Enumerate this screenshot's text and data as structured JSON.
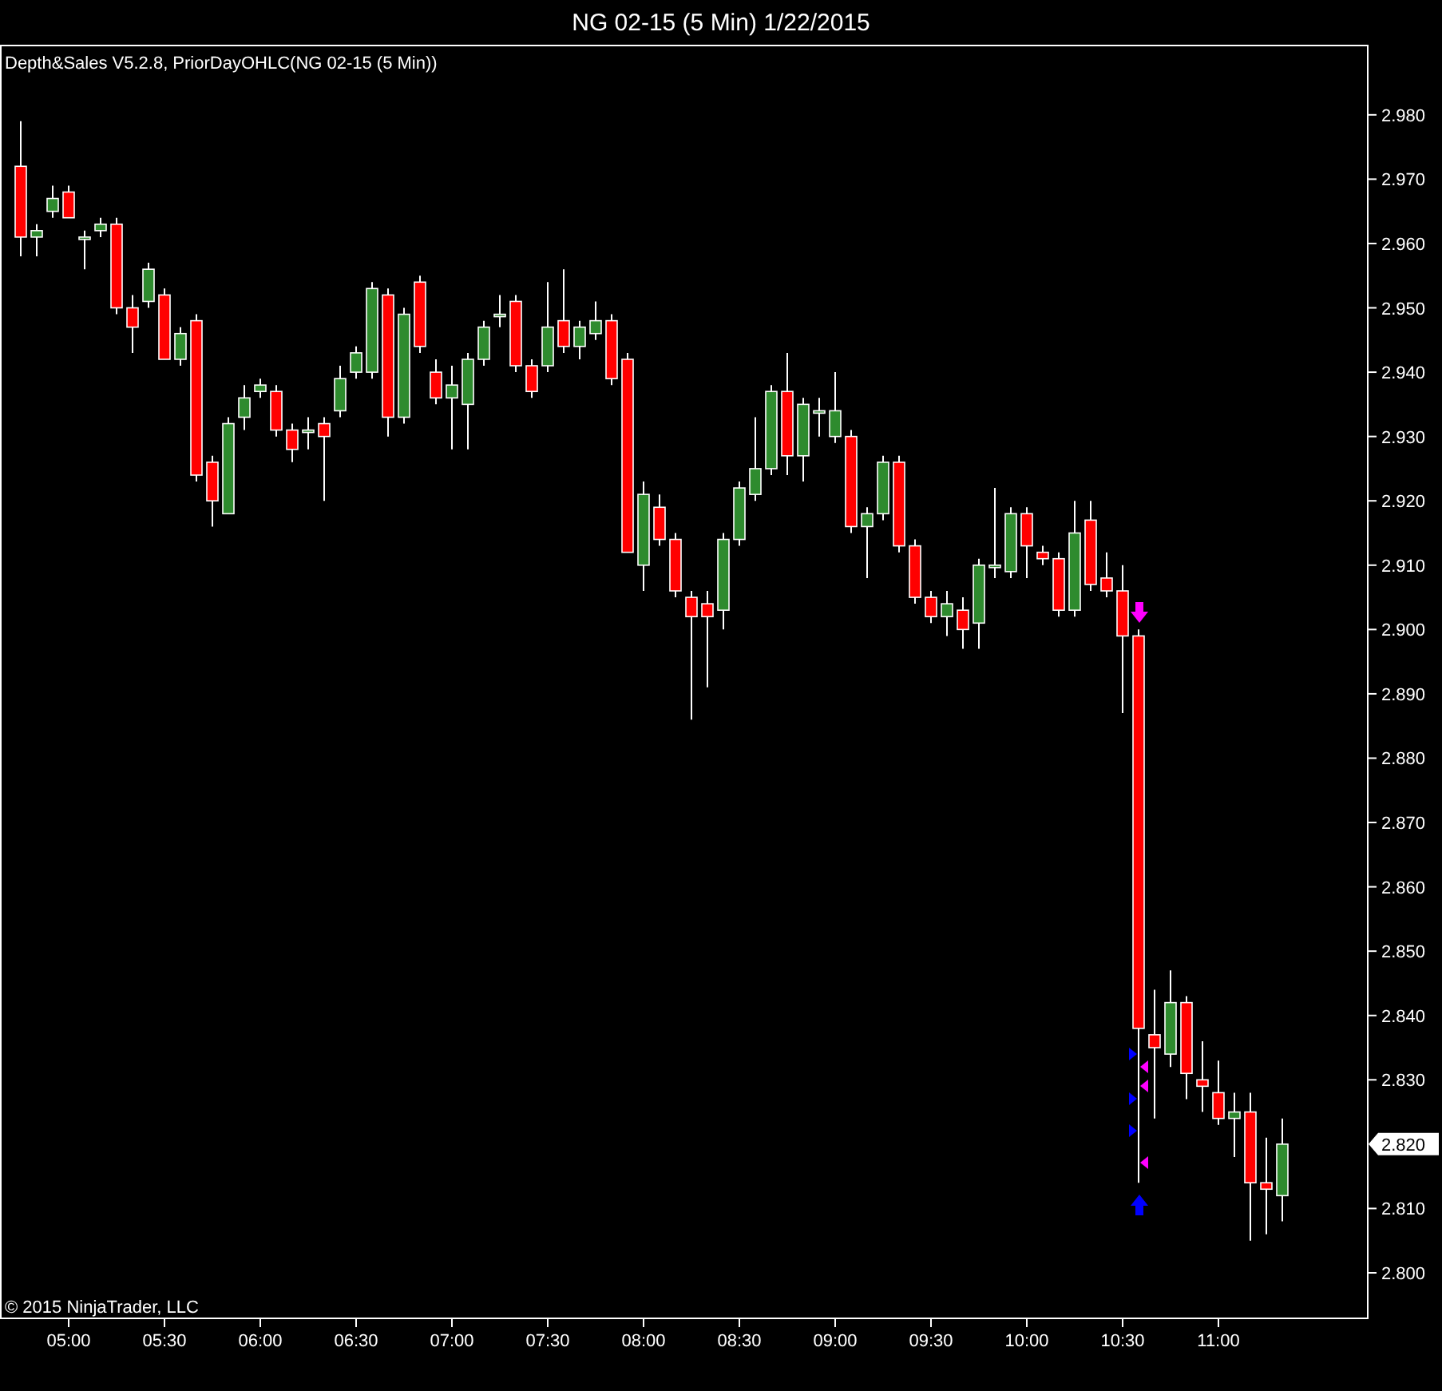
{
  "window": {
    "title": "NG 02-15 (5 Min)  1/22/2015"
  },
  "chart": {
    "indicator_label": "Depth&Sales V5.2.8, PriorDayOHLC(NG 02-15 (5 Min))",
    "chart_data": {
      "type": "candlestick",
      "x": [
        285,
        290,
        295,
        300,
        305,
        310,
        315,
        320,
        325,
        330,
        335,
        340,
        345,
        350,
        355,
        360,
        365,
        370,
        375,
        380,
        385,
        390,
        395,
        400,
        405,
        410,
        415,
        420,
        425,
        430,
        435,
        440,
        445,
        450,
        455,
        460,
        465,
        470,
        475,
        480,
        485,
        490,
        495,
        500,
        505,
        510,
        515,
        520,
        525,
        530,
        535,
        540,
        545,
        550,
        555,
        560,
        565,
        570,
        575,
        580,
        585,
        590,
        595,
        600,
        605,
        610,
        615,
        620,
        625,
        630,
        635,
        640,
        645,
        650,
        655,
        660,
        665,
        670,
        675,
        680
      ],
      "ohlc": [
        [
          2.972,
          2.979,
          2.958,
          2.961
        ],
        [
          2.961,
          2.963,
          2.958,
          2.962
        ],
        [
          2.965,
          2.969,
          2.964,
          2.967
        ],
        [
          2.968,
          2.969,
          2.964,
          2.964
        ],
        [
          2.961,
          2.962,
          2.956,
          2.961
        ],
        [
          2.962,
          2.964,
          2.961,
          2.963
        ],
        [
          2.963,
          2.964,
          2.949,
          2.95
        ],
        [
          2.95,
          2.952,
          2.943,
          2.947
        ],
        [
          2.951,
          2.957,
          2.95,
          2.956
        ],
        [
          2.952,
          2.953,
          2.942,
          2.942
        ],
        [
          2.942,
          2.947,
          2.941,
          2.946
        ],
        [
          2.948,
          2.949,
          2.923,
          2.924
        ],
        [
          2.926,
          2.927,
          2.916,
          2.92
        ],
        [
          2.918,
          2.933,
          2.918,
          2.932
        ],
        [
          2.933,
          2.938,
          2.931,
          2.936
        ],
        [
          2.937,
          2.939,
          2.936,
          2.938
        ],
        [
          2.937,
          2.938,
          2.93,
          2.931
        ],
        [
          2.931,
          2.932,
          2.926,
          2.928
        ],
        [
          2.931,
          2.933,
          2.928,
          2.931
        ],
        [
          2.932,
          2.933,
          2.92,
          2.93
        ],
        [
          2.934,
          2.941,
          2.933,
          2.939
        ],
        [
          2.94,
          2.944,
          2.939,
          2.943
        ],
        [
          2.94,
          2.954,
          2.939,
          2.953
        ],
        [
          2.952,
          2.953,
          2.93,
          2.933
        ],
        [
          2.933,
          2.95,
          2.932,
          2.949
        ],
        [
          2.954,
          2.955,
          2.943,
          2.944
        ],
        [
          2.94,
          2.942,
          2.935,
          2.936
        ],
        [
          2.936,
          2.941,
          2.928,
          2.938
        ],
        [
          2.935,
          2.943,
          2.928,
          2.942
        ],
        [
          2.942,
          2.948,
          2.941,
          2.947
        ],
        [
          2.949,
          2.952,
          2.947,
          2.949
        ],
        [
          2.951,
          2.952,
          2.94,
          2.941
        ],
        [
          2.941,
          2.942,
          2.936,
          2.937
        ],
        [
          2.941,
          2.954,
          2.94,
          2.947
        ],
        [
          2.948,
          2.956,
          2.943,
          2.944
        ],
        [
          2.944,
          2.948,
          2.942,
          2.947
        ],
        [
          2.946,
          2.951,
          2.945,
          2.948
        ],
        [
          2.948,
          2.949,
          2.938,
          2.939
        ],
        [
          2.942,
          2.943,
          2.912,
          2.912
        ],
        [
          2.91,
          2.923,
          2.906,
          2.921
        ],
        [
          2.919,
          2.921,
          2.913,
          2.914
        ],
        [
          2.914,
          2.915,
          2.905,
          2.906
        ],
        [
          2.905,
          2.906,
          2.886,
          2.902
        ],
        [
          2.904,
          2.906,
          2.891,
          2.902
        ],
        [
          2.903,
          2.915,
          2.9,
          2.914
        ],
        [
          2.914,
          2.923,
          2.913,
          2.922
        ],
        [
          2.921,
          2.933,
          2.92,
          2.925
        ],
        [
          2.925,
          2.938,
          2.924,
          2.937
        ],
        [
          2.937,
          2.943,
          2.924,
          2.927
        ],
        [
          2.927,
          2.936,
          2.923,
          2.935
        ],
        [
          2.934,
          2.936,
          2.93,
          2.934
        ],
        [
          2.93,
          2.94,
          2.929,
          2.934
        ],
        [
          2.93,
          2.931,
          2.915,
          2.916
        ],
        [
          2.916,
          2.919,
          2.908,
          2.918
        ],
        [
          2.918,
          2.927,
          2.917,
          2.926
        ],
        [
          2.926,
          2.927,
          2.912,
          2.913
        ],
        [
          2.913,
          2.914,
          2.904,
          2.905
        ],
        [
          2.905,
          2.906,
          2.901,
          2.902
        ],
        [
          2.902,
          2.906,
          2.899,
          2.904
        ],
        [
          2.903,
          2.905,
          2.897,
          2.9
        ],
        [
          2.901,
          2.911,
          2.897,
          2.91
        ],
        [
          2.91,
          2.922,
          2.908,
          2.91
        ],
        [
          2.909,
          2.919,
          2.908,
          2.918
        ],
        [
          2.918,
          2.919,
          2.908,
          2.913
        ],
        [
          2.912,
          2.913,
          2.91,
          2.911
        ],
        [
          2.911,
          2.912,
          2.902,
          2.903
        ],
        [
          2.903,
          2.92,
          2.902,
          2.915
        ],
        [
          2.917,
          2.92,
          2.906,
          2.907
        ],
        [
          2.908,
          2.912,
          2.905,
          2.906
        ],
        [
          2.906,
          2.91,
          2.887,
          2.899
        ],
        [
          2.899,
          2.9,
          2.814,
          2.838
        ],
        [
          2.837,
          2.844,
          2.824,
          2.835
        ],
        [
          2.834,
          2.847,
          2.832,
          2.842
        ],
        [
          2.842,
          2.843,
          2.827,
          2.831
        ],
        [
          2.83,
          2.836,
          2.825,
          2.829
        ],
        [
          2.828,
          2.833,
          2.823,
          2.824
        ],
        [
          2.824,
          2.828,
          2.818,
          2.825
        ],
        [
          2.825,
          2.828,
          2.805,
          2.814
        ],
        [
          2.814,
          2.821,
          2.806,
          2.813
        ],
        [
          2.812,
          2.824,
          2.808,
          2.82
        ]
      ],
      "xlim": [
        278.5,
        707
      ],
      "ylim": [
        2.7928,
        2.9909
      ],
      "xticks": [
        {
          "value": 300,
          "label": "05:00"
        },
        {
          "value": 330,
          "label": "05:30"
        },
        {
          "value": 360,
          "label": "06:00"
        },
        {
          "value": 390,
          "label": "06:30"
        },
        {
          "value": 420,
          "label": "07:00"
        },
        {
          "value": 450,
          "label": "07:30"
        },
        {
          "value": 480,
          "label": "08:00"
        },
        {
          "value": 510,
          "label": "08:30"
        },
        {
          "value": 540,
          "label": "09:00"
        },
        {
          "value": 570,
          "label": "09:30"
        },
        {
          "value": 600,
          "label": "10:00"
        },
        {
          "value": 630,
          "label": "10:30"
        },
        {
          "value": 660,
          "label": "11:00"
        }
      ],
      "yticks": [
        {
          "value": 2.98,
          "label": "2.980"
        },
        {
          "value": 2.97,
          "label": "2.970"
        },
        {
          "value": 2.96,
          "label": "2.960"
        },
        {
          "value": 2.95,
          "label": "2.950"
        },
        {
          "value": 2.94,
          "label": "2.940"
        },
        {
          "value": 2.93,
          "label": "2.930"
        },
        {
          "value": 2.92,
          "label": "2.920"
        },
        {
          "value": 2.91,
          "label": "2.910"
        },
        {
          "value": 2.9,
          "label": "2.900"
        },
        {
          "value": 2.89,
          "label": "2.890"
        },
        {
          "value": 2.88,
          "label": "2.880"
        },
        {
          "value": 2.87,
          "label": "2.870"
        },
        {
          "value": 2.86,
          "label": "2.860"
        },
        {
          "value": 2.85,
          "label": "2.850"
        },
        {
          "value": 2.84,
          "label": "2.840"
        },
        {
          "value": 2.83,
          "label": "2.830"
        },
        {
          "value": 2.81,
          "label": "2.810"
        },
        {
          "value": 2.8,
          "label": "2.800"
        }
      ]
    },
    "last_price": "2.820",
    "copyright": "© 2015 NinjaTrader, LLC"
  }
}
